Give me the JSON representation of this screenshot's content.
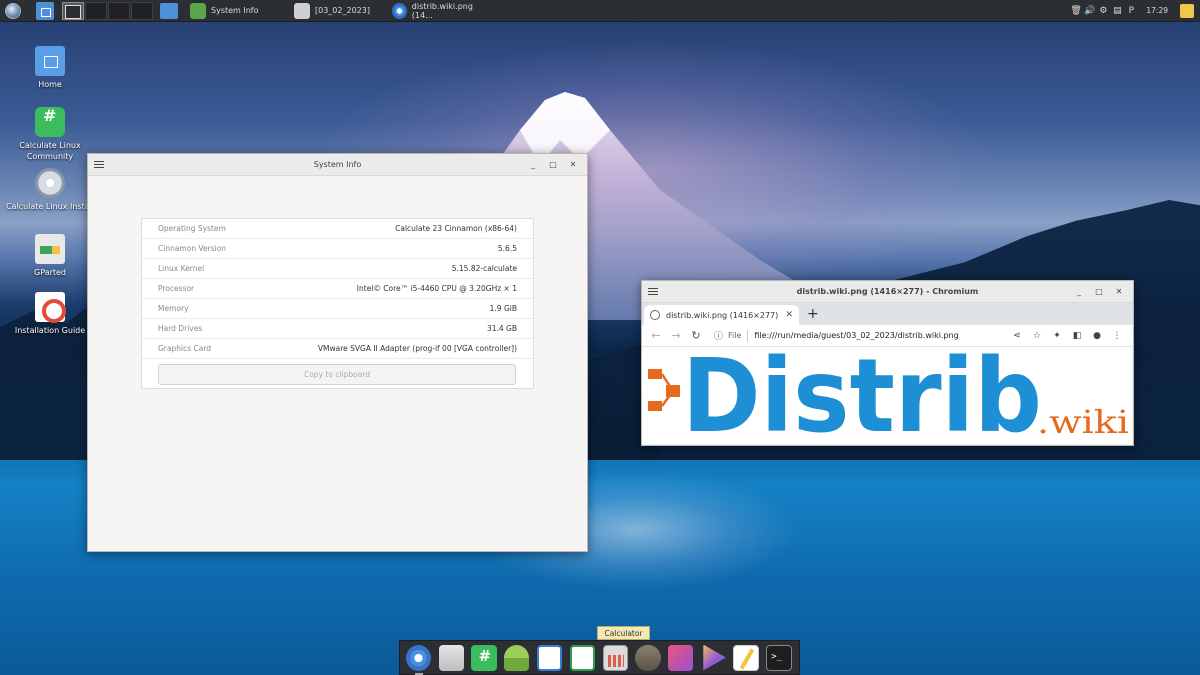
{
  "top_panel": {
    "tasks": [
      {
        "label": "System Info"
      },
      {
        "label": "[03_02_2023]"
      },
      {
        "label": "distrib.wiki.png (14..."
      }
    ],
    "clock": "17:29"
  },
  "desktop_icons": [
    {
      "label": "Home"
    },
    {
      "label": "Calculate Linux Community"
    },
    {
      "label": "Calculate Linux Install"
    },
    {
      "label": "GParted"
    },
    {
      "label": "Installation Guide"
    }
  ],
  "sysinfo": {
    "title": "System Info",
    "rows": [
      {
        "key": "Operating System",
        "value": "Calculate 23 Cinnamon (x86-64)"
      },
      {
        "key": "Cinnamon Version",
        "value": "5.6.5"
      },
      {
        "key": "Linux Kernel",
        "value": "5.15.82-calculate"
      },
      {
        "key": "Processor",
        "value": "Intel© Core™ i5-4460  CPU @ 3.20GHz × 1"
      },
      {
        "key": "Memory",
        "value": "1.9 GiB"
      },
      {
        "key": "Hard Drives",
        "value": "31.4 GB"
      },
      {
        "key": "Graphics Card",
        "value": "VMware SVGA II Adapter (prog-if 00 [VGA controller])"
      }
    ],
    "copy_button": "Copy to clipboard"
  },
  "chromium": {
    "title": "distrib.wiki.png (1416×277) - Chromium",
    "tab_title": "distrib.wiki.png (1416×277)",
    "scheme_label": "File",
    "url": "file:///run/media/guest/03_02_2023/distrib.wiki.png",
    "image": {
      "brand": "Distrib",
      "suffix": ".wiki",
      "brand_color": "#1e8fd4",
      "suffix_color": "#e46a1f"
    }
  },
  "dock": {
    "tooltip": "Calculator",
    "items": [
      "chromium-icon",
      "time-icon",
      "chat-icon",
      "user-icon",
      "writer-icon",
      "spreadsheet-icon",
      "calculator-icon",
      "gimp-icon",
      "screenshot-icon",
      "video-icon",
      "notes-icon",
      "terminal-icon"
    ]
  }
}
